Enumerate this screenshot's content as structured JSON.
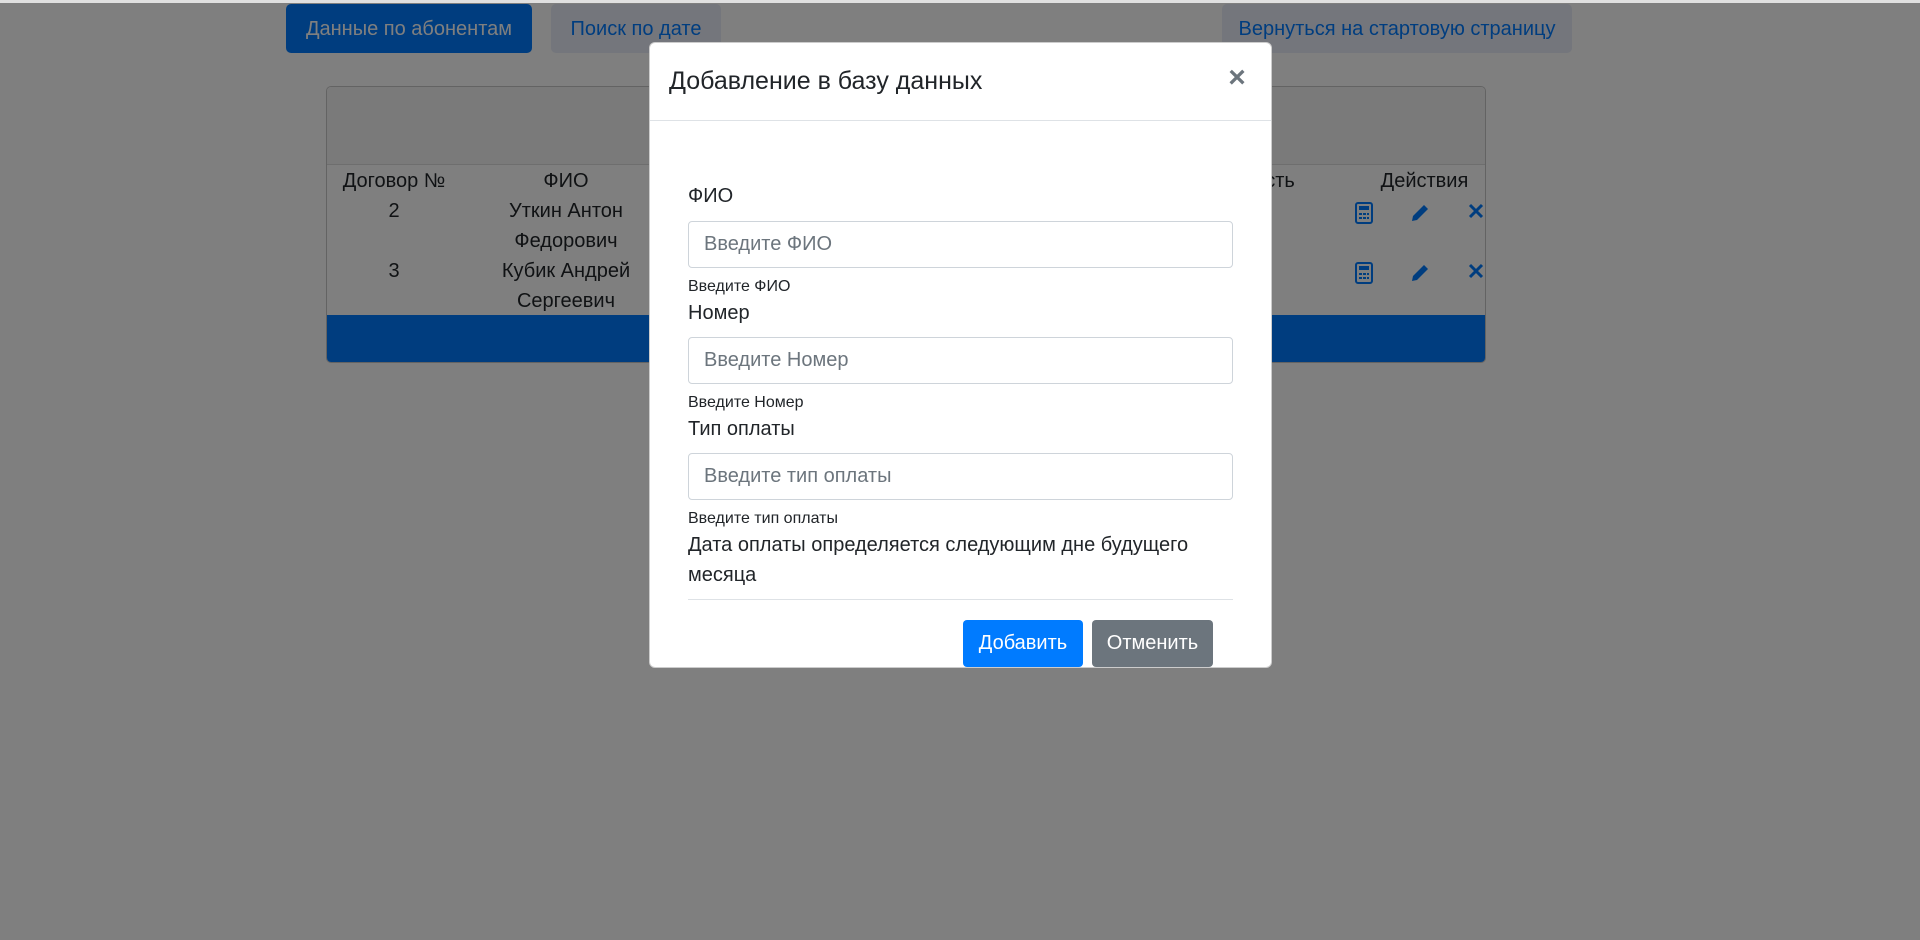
{
  "nav": {
    "subscribers_label": "Данные по абонентам",
    "date_search_label": "Поиск по дате",
    "home_label": "Вернуться на стартовую страницу"
  },
  "table": {
    "headers": {
      "contract": "Договор №",
      "fio": "ФИО",
      "cost": "ость",
      "actions": "Действия"
    },
    "rows": [
      {
        "contract": "2",
        "fio_line1": "Уткин Антон",
        "fio_line2": "Федорович"
      },
      {
        "contract": "3",
        "fio_line1": "Кубик Андрей",
        "fio_line2": "Сергеевич"
      }
    ],
    "action_icons": [
      "calculator-icon",
      "pencil-icon",
      "close-icon"
    ]
  },
  "modal": {
    "title": "Добавление в базу данных",
    "close_glyph": "×",
    "fields": {
      "fio": {
        "label": "ФИО",
        "placeholder": "Введите ФИО",
        "help": "Введите ФИО"
      },
      "number": {
        "label": "Номер",
        "placeholder": "Введите Номер",
        "help": "Введите Номер"
      },
      "payment_type": {
        "label": "Тип оплаты",
        "placeholder": "Введите тип оплаты",
        "help": "Введите тип оплаты"
      }
    },
    "note": "Дата оплаты определяется следующим дне будущего месяца",
    "add_label": "Добавить",
    "cancel_label": "Отменить"
  },
  "colors": {
    "primary": "#007bff",
    "secondary": "#6c757d",
    "backdrop": "rgba(0,0,0,0.5)"
  }
}
